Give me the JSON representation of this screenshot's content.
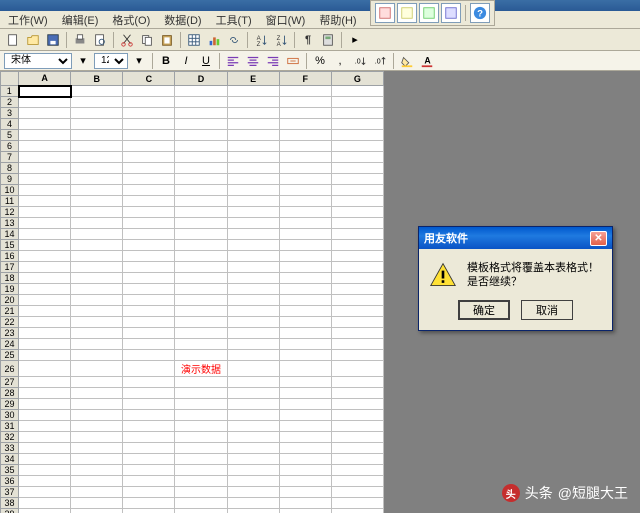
{
  "menu": {
    "file": "工作(W)",
    "edit": "编辑(E)",
    "format": "格式(O)",
    "data": "数据(D)",
    "tools": "工具(T)",
    "window": "窗口(W)",
    "help": "帮助(H)"
  },
  "format_bar": {
    "font_name": "宋体",
    "font_size": "12",
    "bold": "B",
    "italic": "I",
    "underline": "U",
    "percent": "%"
  },
  "columns": [
    "A",
    "B",
    "C",
    "D",
    "E",
    "F",
    "G"
  ],
  "demo_text": "演示数据",
  "demo_row": 26,
  "demo_col": 3,
  "row_count": 39,
  "selected": {
    "row": 1,
    "col": 0
  },
  "dialog": {
    "title": "用友软件",
    "message": "模板格式将覆盖本表格式！是否继续？",
    "ok": "确定",
    "cancel": "取消"
  },
  "watermark": {
    "logo_char": "头",
    "prefix": "头条",
    "handle": "@短腿大王"
  }
}
